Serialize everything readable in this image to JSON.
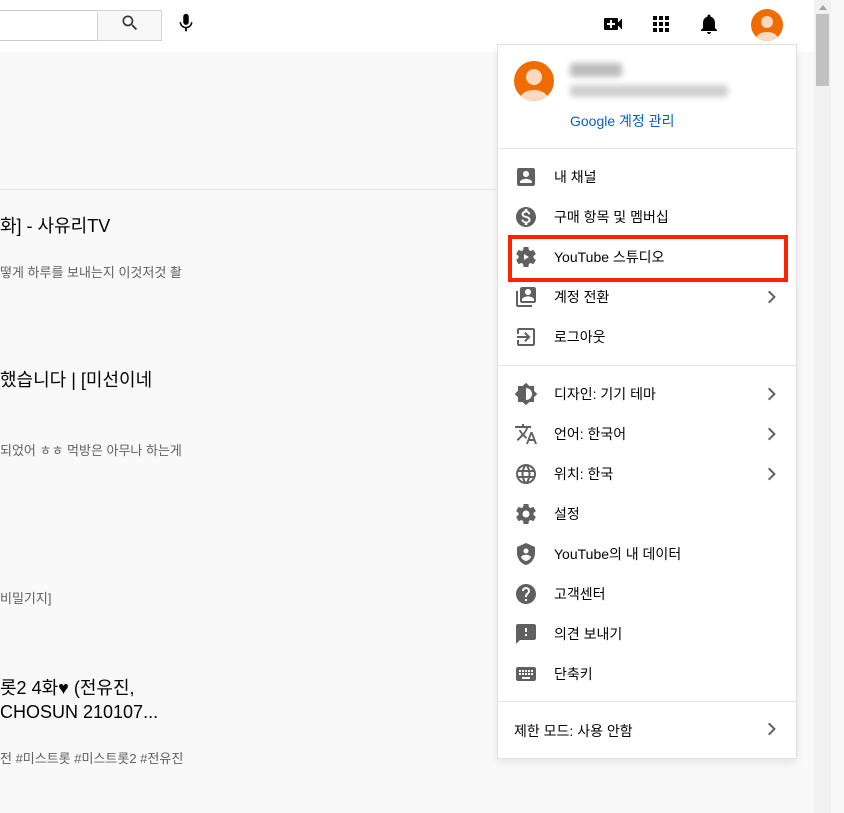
{
  "search": {
    "value": "",
    "placeholder": ""
  },
  "icons": {
    "search": "search-icon",
    "mic": "microphone-icon",
    "create": "video-camera-add-icon",
    "apps": "apps-grid-icon",
    "notifications": "bell-icon",
    "account": "avatar"
  },
  "background": {
    "items": [
      {
        "title": "화] - 사유리TV",
        "desc": "떻게 하루를 보내는지 이것저것 촬"
      },
      {
        "title": "했습니다 | [미선이네",
        "desc": "되었어 ㅎㅎ 먹방은 아무나 하는게"
      },
      {
        "title": "",
        "desc": "비밀기지]"
      },
      {
        "title_line1": "롯2 4화♥ (전유진,",
        "title_line2": " CHOSUN 210107...",
        "desc": "전 #미스트롯 #미스트롯2 #전유진"
      }
    ]
  },
  "account_menu": {
    "manage_account": "Google 계정 관리",
    "section1": [
      {
        "label": "내 채널",
        "icon": "person-icon"
      },
      {
        "label": "구매 항목 및 멤버십",
        "icon": "dollar-icon"
      },
      {
        "label": "YouTube 스튜디오",
        "icon": "gear-play-icon"
      },
      {
        "label": "계정 전환",
        "icon": "switch-account-icon",
        "chevron": true
      },
      {
        "label": "로그아웃",
        "icon": "sign-out-icon"
      }
    ],
    "section2": [
      {
        "label": "디자인: 기기 테마",
        "icon": "brightness-icon",
        "chevron": true
      },
      {
        "label": "언어: 한국어",
        "icon": "translate-icon",
        "chevron": true
      },
      {
        "label": "위치: 한국",
        "icon": "globe-icon",
        "chevron": true
      },
      {
        "label": "설정",
        "icon": "gear-icon"
      },
      {
        "label": "YouTube의 내 데이터",
        "icon": "shield-person-icon"
      },
      {
        "label": "고객센터",
        "icon": "help-icon"
      },
      {
        "label": "의견 보내기",
        "icon": "feedback-icon"
      },
      {
        "label": "단축키",
        "icon": "keyboard-icon"
      }
    ],
    "restricted_mode": "제한 모드: 사용 안함"
  },
  "colors": {
    "link": "#065fd4",
    "avatar": "#ef6c00",
    "highlight": "#ff2200",
    "icon": "#606060"
  }
}
